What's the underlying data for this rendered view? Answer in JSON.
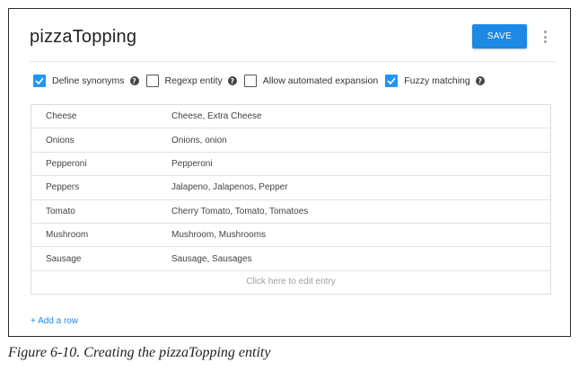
{
  "entity": {
    "title": "pizzaTopping",
    "save_label": "SAVE",
    "more_icon": "kebab-menu-icon"
  },
  "options": [
    {
      "label": "Define synonyms",
      "checked": true,
      "help": true
    },
    {
      "label": "Regexp entity",
      "checked": false,
      "help": true
    },
    {
      "label": "Allow automated expansion",
      "checked": false,
      "help": false
    },
    {
      "label": "Fuzzy matching",
      "checked": true,
      "help": true
    }
  ],
  "help_glyph": "?",
  "rows": [
    {
      "reference": "Cheese",
      "synonyms": "Cheese, Extra Cheese"
    },
    {
      "reference": "Onions",
      "synonyms": "Onions, onion"
    },
    {
      "reference": "Pepperoni",
      "synonyms": "Pepperoni"
    },
    {
      "reference": "Peppers",
      "synonyms": "Jalapeno, Jalapenos, Pepper"
    },
    {
      "reference": "Tomato",
      "synonyms": "Cherry Tomato, Tomato, Tomatoes"
    },
    {
      "reference": "Mushroom",
      "synonyms": "Mushroom, Mushrooms"
    },
    {
      "reference": "Sausage",
      "synonyms": "Sausage, Sausages"
    }
  ],
  "edit_placeholder": "Click here to edit entry",
  "add_row_label": "+ Add a row",
  "caption": "Figure 6-10. Creating the pizzaTopping entity",
  "colors": {
    "accent": "#1e88e5",
    "checkbox_checked": "#2196f3"
  }
}
